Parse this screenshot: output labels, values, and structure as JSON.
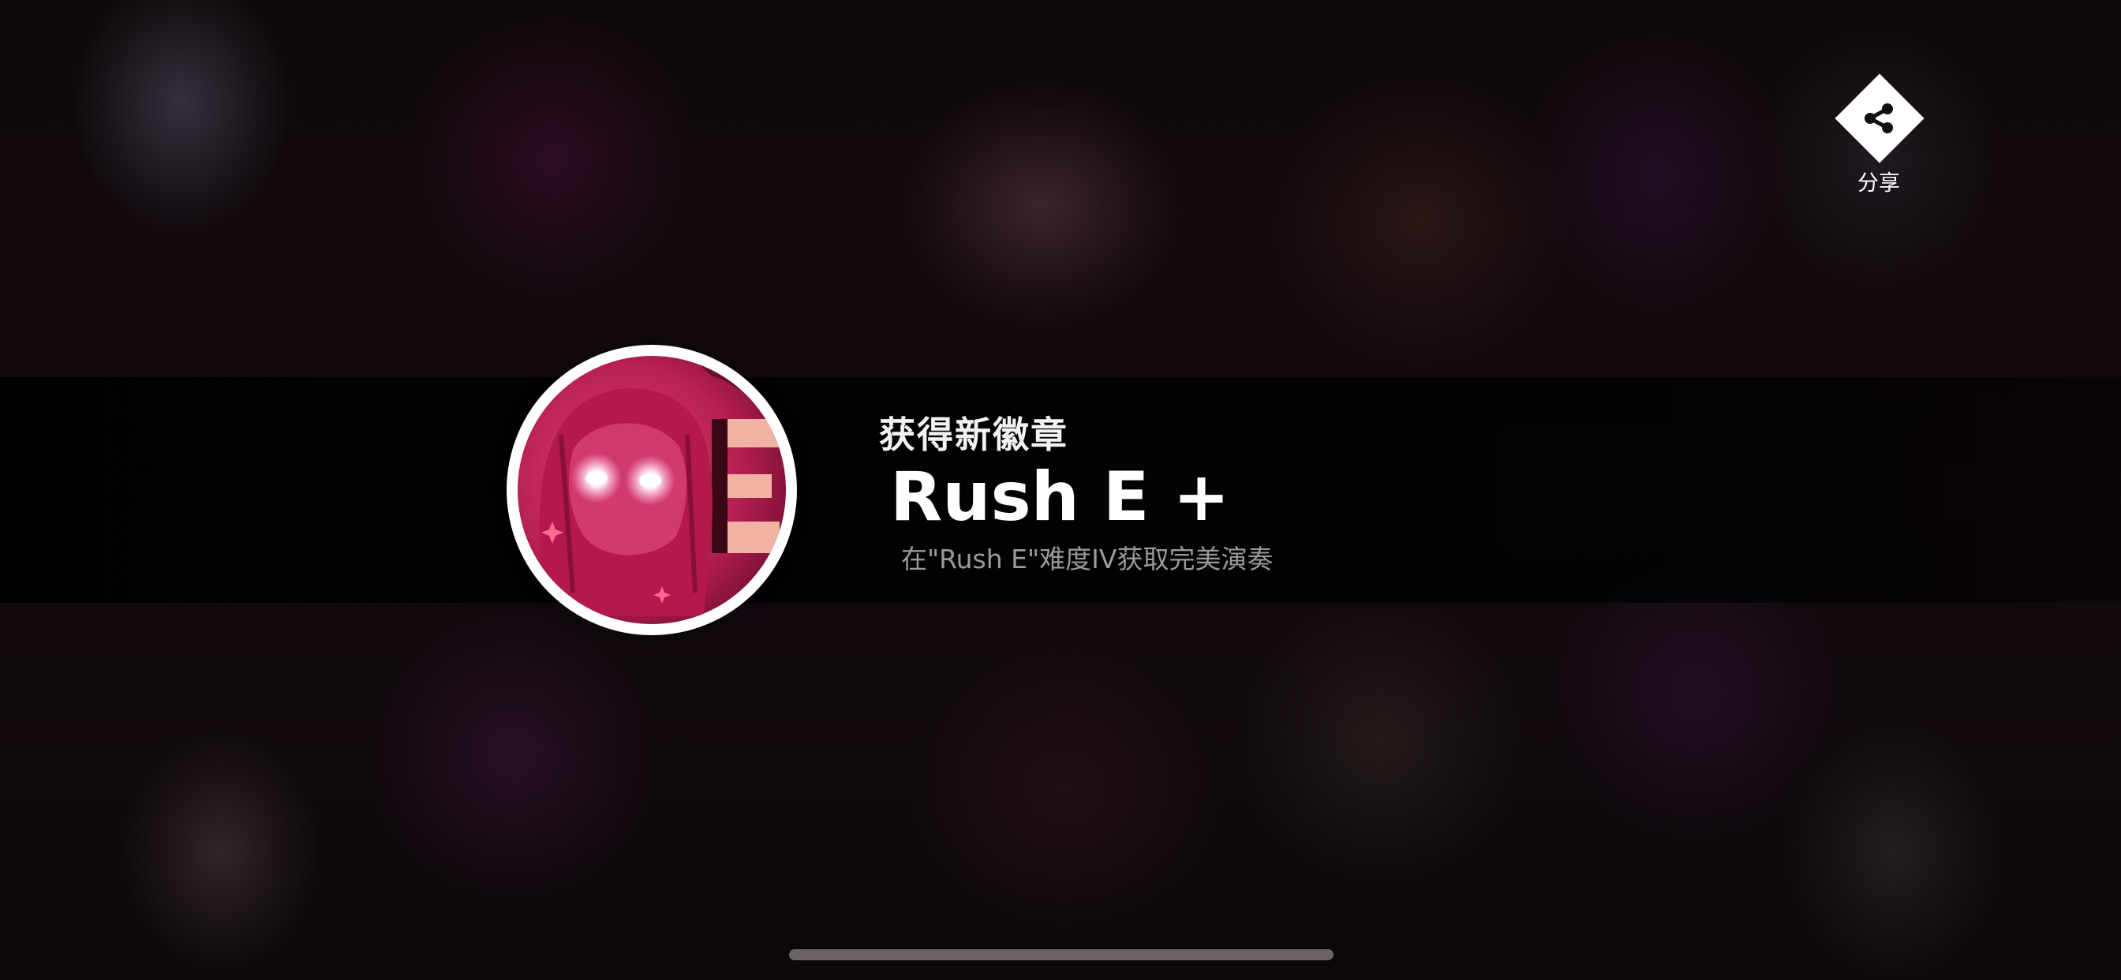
{
  "share": {
    "icon": "share-icon",
    "label": "分享"
  },
  "achievement": {
    "heading": "获得新徽章",
    "badge_name": "Rush E +",
    "description": "在\"Rush E\"难度IV获取完美演奏",
    "badge_art": "glowing-eyes-portrait"
  },
  "colors": {
    "badge_art_pink": "#c2275f",
    "badge_border": "#ffffff",
    "banner": "#000000"
  }
}
